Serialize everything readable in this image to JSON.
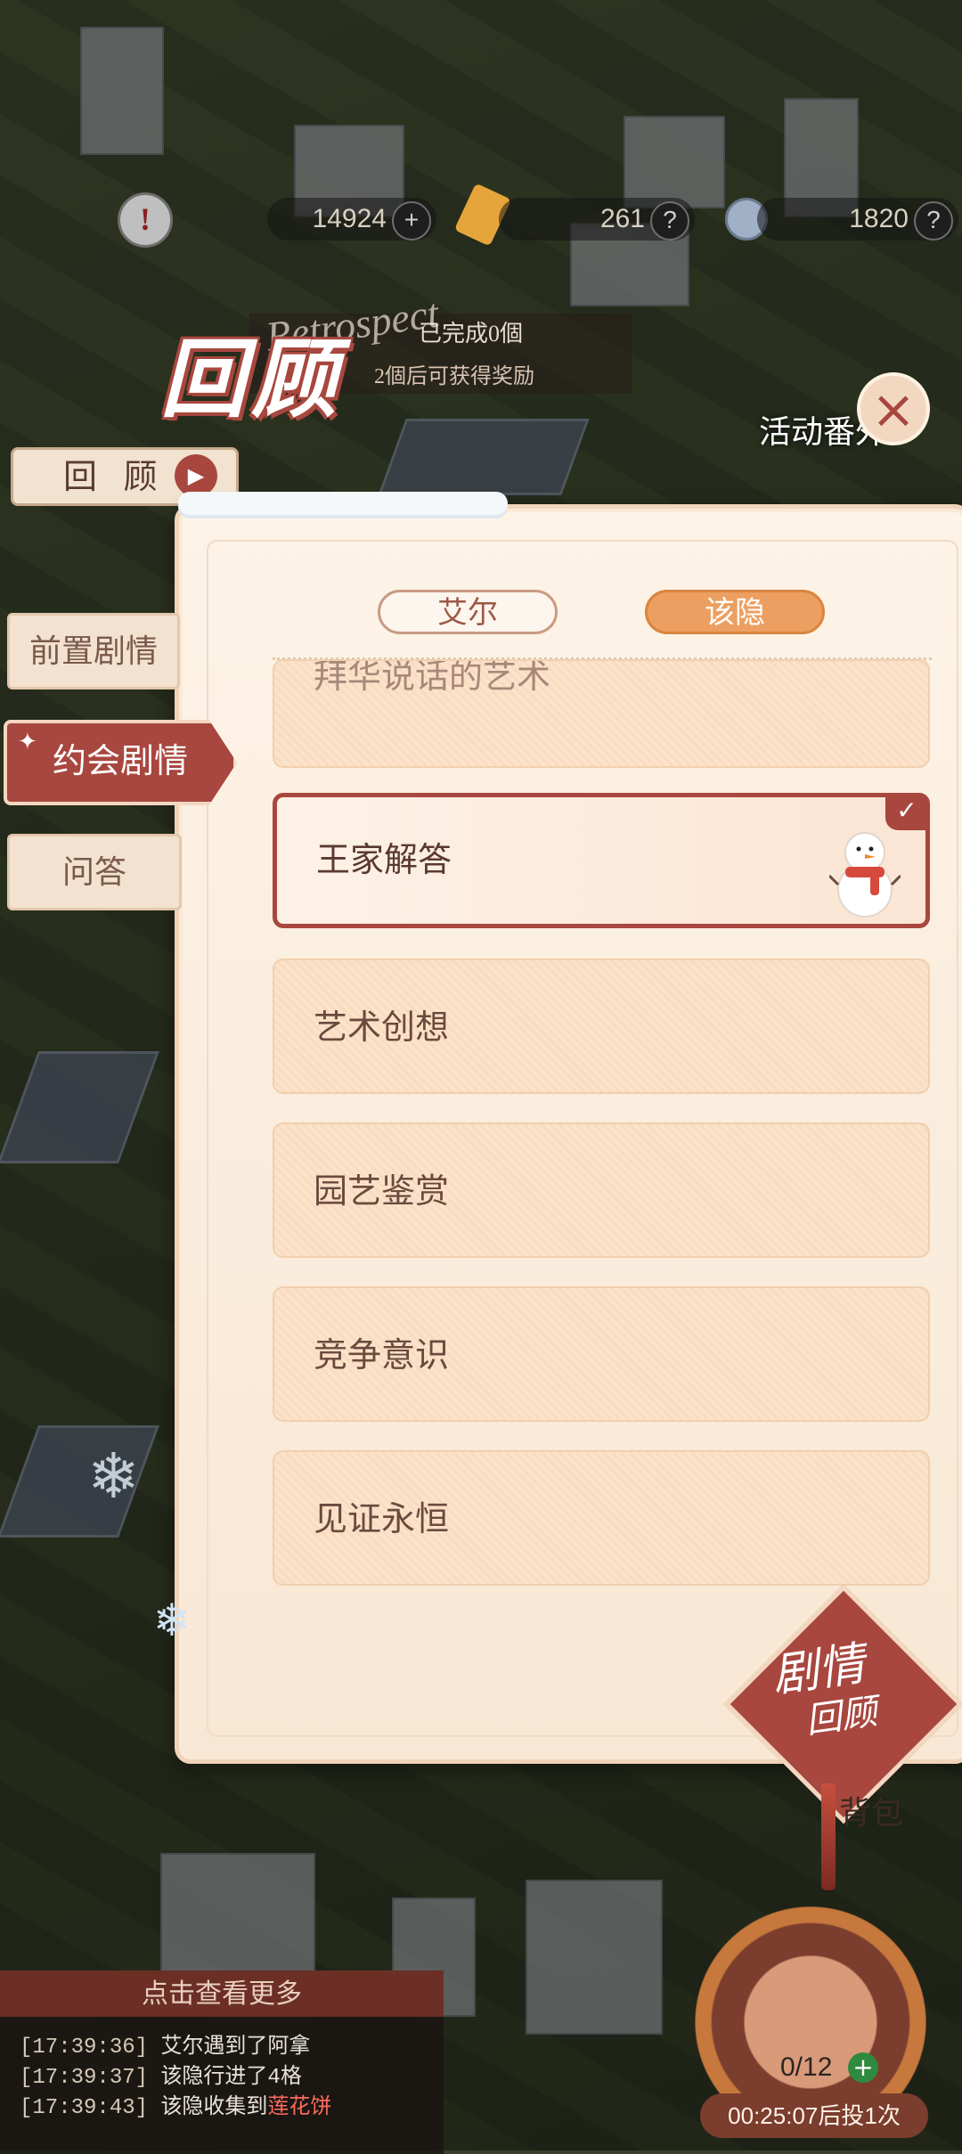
{
  "top_bar": {
    "coins": "14924",
    "gems": "261",
    "tickets": "1820",
    "plus": "+",
    "help": "?"
  },
  "title": {
    "main": "回顾",
    "script": "Retrospect",
    "banner_line1": "已完成0個",
    "banner_line2": "2個后可获得奖励"
  },
  "event_label": "活动番外",
  "close_icon": "×",
  "review_button": "回 顾",
  "side_tabs": {
    "pre": "前置剧情",
    "date": "约会剧情",
    "qa": "问答"
  },
  "header_tabs": {
    "aier": "艾尔",
    "gaiyin": "该隐"
  },
  "list_items": [
    {
      "label": "拜华说话的艺术"
    },
    {
      "label": "王家解答",
      "selected": true
    },
    {
      "label": "艺术创想"
    },
    {
      "label": "园艺鉴赏"
    },
    {
      "label": "竞争意识"
    },
    {
      "label": "见证永恒"
    }
  ],
  "badge": {
    "line1": "剧情",
    "line2": "回顾"
  },
  "backpack": "背包",
  "log": {
    "header": "点击查看更多",
    "lines": [
      {
        "ts": "[17:39:36]",
        "text": "艾尔遇到了阿拿"
      },
      {
        "ts": "[17:39:37]",
        "text": "该隐行进了4格"
      },
      {
        "ts": "[17:39:43]",
        "text": "该隐收集到",
        "highlight": "莲花饼"
      }
    ]
  },
  "counter": "0/12",
  "timer": "00:25:07后投1次",
  "colors": {
    "accent": "#a8473f",
    "orange": "#ec9f60",
    "panel": "#fbe9d7"
  }
}
